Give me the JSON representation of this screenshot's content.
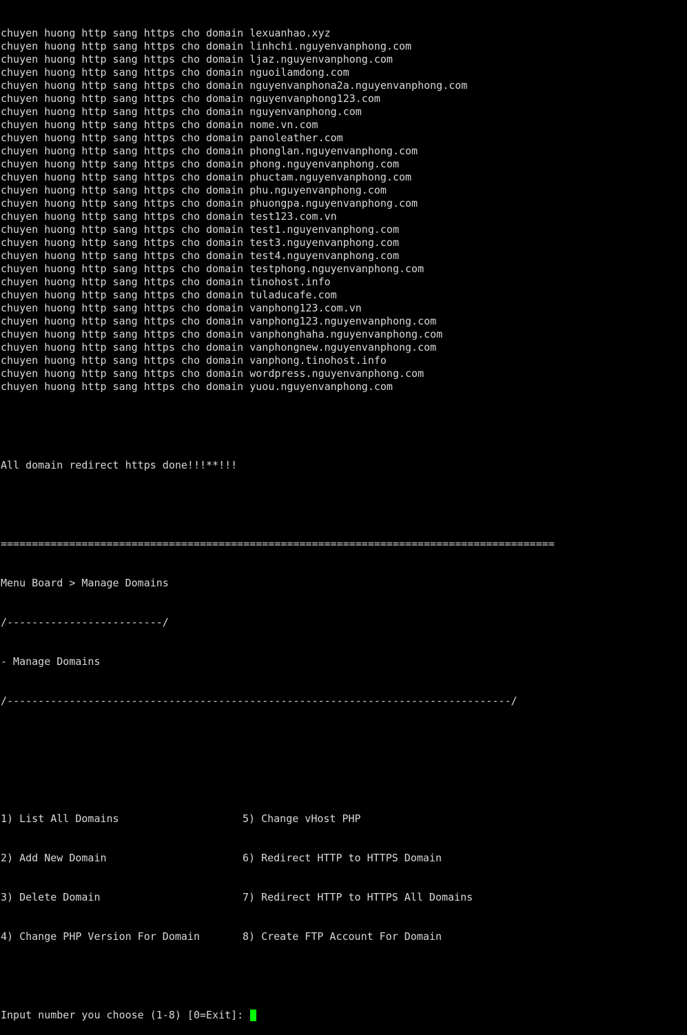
{
  "redirect_prefix": "chuyen huong http sang https cho domain ",
  "redirect_domains": [
    "lexuanhao.xyz",
    "linhchi.nguyenvanphong.com",
    "ljaz.nguyenvanphong.com",
    "nguoilamdong.com",
    "nguyenvanphona2a.nguyenvanphong.com",
    "nguyenvanphong123.com",
    "nguyenvanphong.com",
    "nome.vn.com",
    "panoleather.com",
    "phonglan.nguyenvanphong.com",
    "phong.nguyenvanphong.com",
    "phuctam.nguyenvanphong.com",
    "phu.nguyenvanphong.com",
    "phuongpa.nguyenvanphong.com",
    "test123.com.vn",
    "test1.nguyenvanphong.com",
    "test3.nguyenvanphong.com",
    "test4.nguyenvanphong.com",
    "testphong.nguyenvanphong.com",
    "tinohost.info",
    "tuladucafe.com",
    "vanphong123.com.vn",
    "vanphong123.nguyenvanphong.com",
    "vanphonghaha.nguyenvanphong.com",
    "vanphongnew.nguyenvanphong.com",
    "vanphong.tinohost.info",
    "wordpress.nguyenvanphong.com",
    "yuou.nguyenvanphong.com"
  ],
  "done_message": "All domain redirect https done!!!**!!!",
  "separator_line": "=========================================================================================",
  "breadcrumb": "Menu Board > Manage Domains",
  "breadcrumb_underline": "/-------------------------/",
  "section_title": "- Manage Domains",
  "section_underline": "/---------------------------------------------------------------------------------/",
  "menu": {
    "left": [
      "1) List All Domains",
      "2) Add New Domain",
      "3) Delete Domain",
      "4) Change PHP Version For Domain"
    ],
    "right": [
      "5) Change vHost PHP",
      "6) Redirect HTTP to HTTPS Domain",
      "7) Redirect HTTP to HTTPS All Domains",
      "8) Create FTP Account For Domain"
    ]
  },
  "prompt": "Input number you choose (1-8) [0=Exit]: ",
  "colors": {
    "background": "#000000",
    "text": "#d9d9d9",
    "cursor": "#00ff00"
  }
}
